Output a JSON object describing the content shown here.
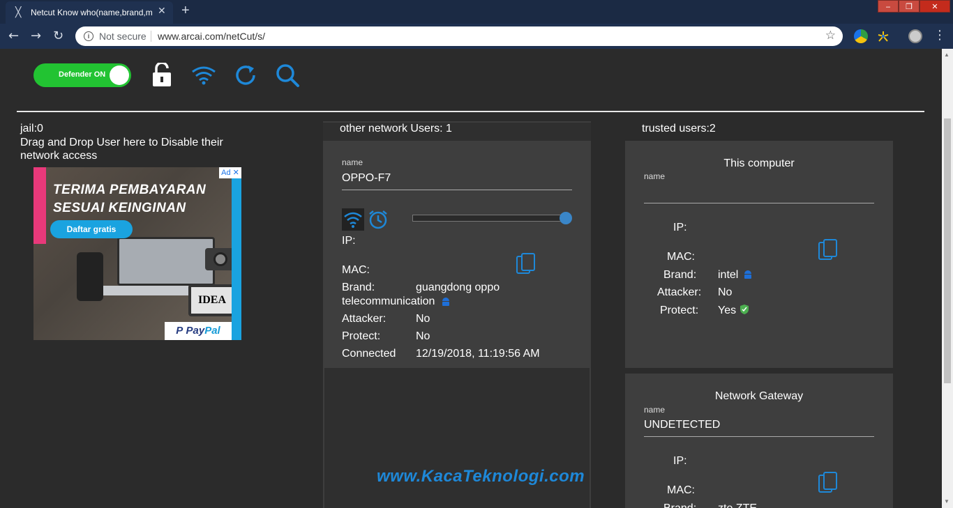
{
  "browser": {
    "tab_title": "Netcut Know who(name,brand,m",
    "tab_close": "✕",
    "new_tab": "+",
    "security_label": "Not secure",
    "url": "www.arcai.com/netCut/s/",
    "win_min": "‒",
    "win_max": "❐",
    "win_close": "✕"
  },
  "toolbar": {
    "defender_label": "Defender ON",
    "icons": [
      "lock-open-icon",
      "wifi-icon",
      "refresh-icon",
      "search-icon"
    ]
  },
  "jail": {
    "title": "jail:0",
    "description": "Drag and Drop User here to Disable their network access"
  },
  "ad": {
    "headline_1": "TERIMA PEMBAYARAN",
    "headline_2": "SESUAI KEINGINAN",
    "button": "Daftar gratis",
    "tablet_text": "IDEA",
    "paypal_pay": "Pay",
    "paypal_pal": "Pal",
    "choice": "Ad ✕"
  },
  "other_users": {
    "title": "other network Users: 1",
    "user": {
      "name_label": "name",
      "name": "OPPO-F7",
      "ip_label": "IP:",
      "mac_label": "MAC:",
      "brand_label": "Brand:",
      "brand_value_1": "guangdong oppo",
      "brand_value_2": "telecommunication",
      "attacker_label": "Attacker:",
      "attacker": "No",
      "protect_label": "Protect:",
      "protect": "No",
      "connected_label": "Connected",
      "connected": "12/19/2018, 11:19:56 AM",
      "slider_level": 1.0
    }
  },
  "trusted": {
    "title": "trusted users:2",
    "this_computer": {
      "heading": "This computer",
      "name_label": "name",
      "ip_label": "IP:",
      "mac_label": "MAC:",
      "brand_label": "Brand:",
      "brand": "intel",
      "attacker_label": "Attacker:",
      "attacker": "No",
      "protect_label": "Protect:",
      "protect": "Yes"
    },
    "gateway": {
      "heading": "Network Gateway",
      "name_label": "name",
      "name": "UNDETECTED",
      "ip_label": "IP:",
      "mac_label": "MAC:",
      "brand_label": "Brand:",
      "brand": "zte ZTE"
    }
  },
  "watermark": "www.KacaTeknologi.com",
  "colors": {
    "accent": "#1e88d8",
    "defender": "#22c332",
    "background": "#2b2b2b",
    "card": "#3e3e3e"
  }
}
